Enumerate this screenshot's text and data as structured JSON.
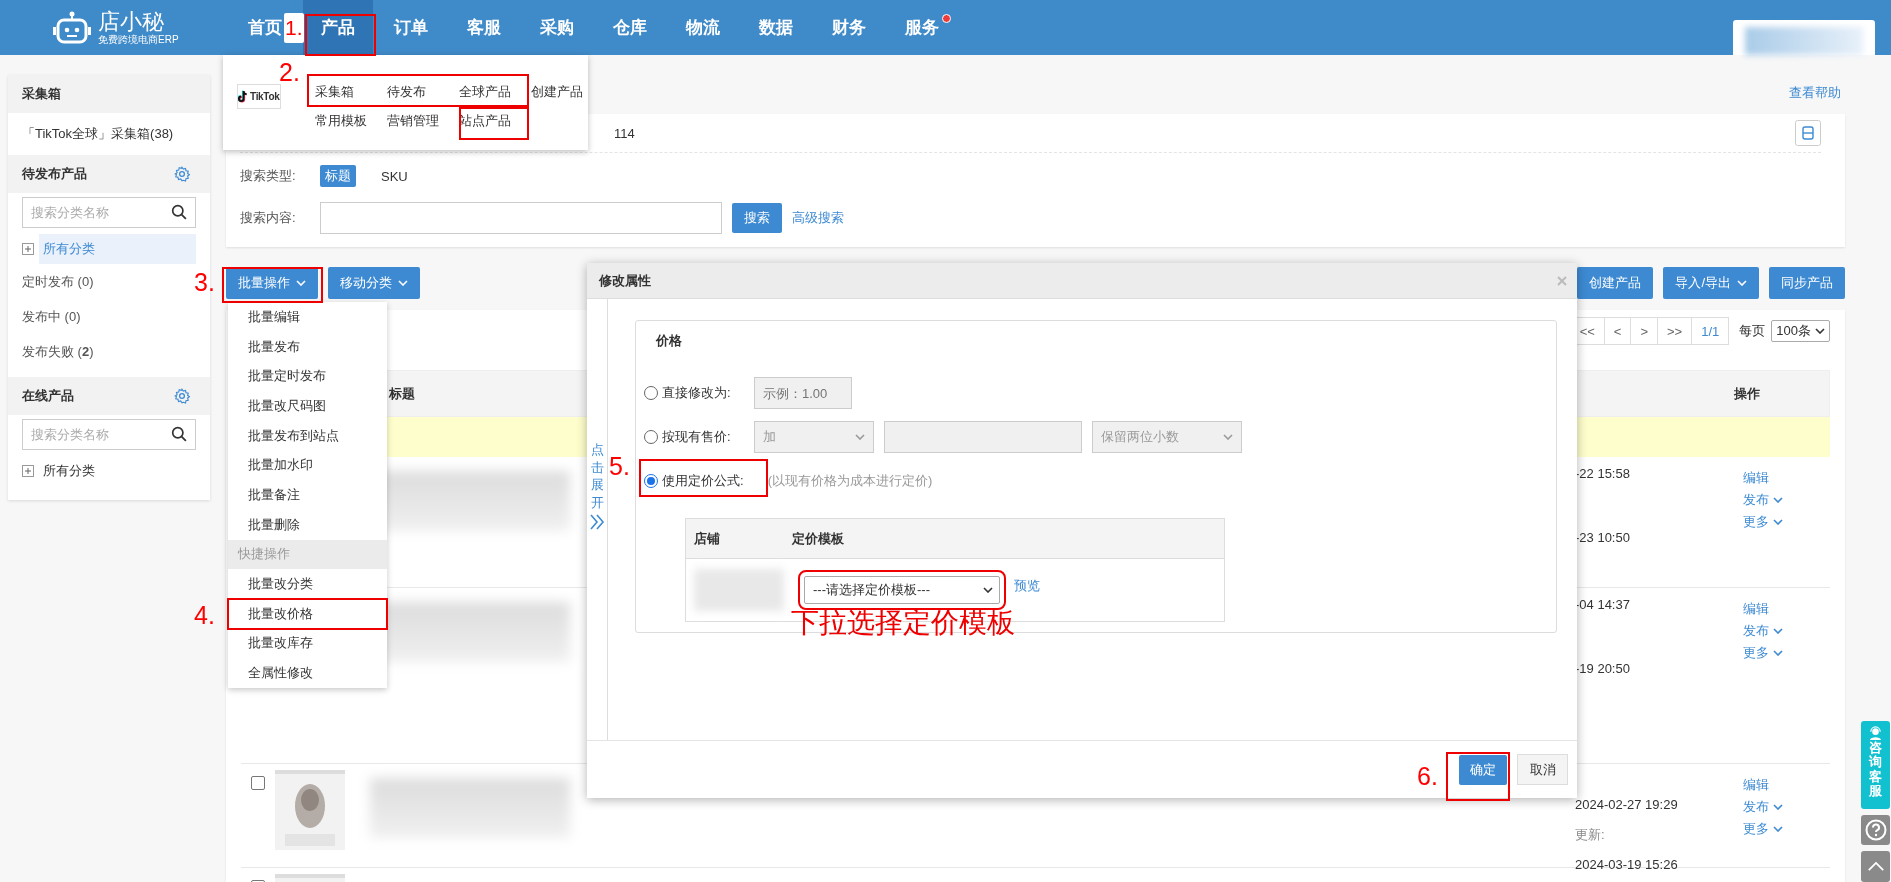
{
  "top_nav": {
    "logo_name": "店小秘",
    "logo_tagline": "免费跨境电商ERP",
    "items": [
      {
        "label": "首页",
        "selected": false,
        "badge": false
      },
      {
        "label": "产品",
        "selected": true,
        "badge": false
      },
      {
        "label": "订单",
        "selected": false,
        "badge": false
      },
      {
        "label": "客服",
        "selected": false,
        "badge": false
      },
      {
        "label": "采购",
        "selected": false,
        "badge": false
      },
      {
        "label": "仓库",
        "selected": false,
        "badge": false
      },
      {
        "label": "物流",
        "selected": false,
        "badge": false
      },
      {
        "label": "数据",
        "selected": false,
        "badge": false
      },
      {
        "label": "财务",
        "selected": false,
        "badge": false
      },
      {
        "label": "服务",
        "selected": false,
        "badge": true
      }
    ]
  },
  "product_menu": {
    "platform_logo": "TikTok",
    "rows": [
      [
        {
          "label": "采集箱"
        },
        {
          "label": "待发布"
        },
        {
          "label": "全球产品"
        },
        {
          "label": "创建产品"
        }
      ],
      [
        {
          "label": "常用模板"
        },
        {
          "label": "营销管理"
        },
        {
          "label": "站点产品"
        }
      ]
    ]
  },
  "sidebar": {
    "collect_title": "采集箱",
    "collect_items": [
      {
        "label": "「TikTok全球」采集箱(38)"
      }
    ],
    "pending": {
      "title": "待发布产品",
      "search_placeholder": "搜索分类名称",
      "tree_label": "所有分类",
      "tree_selected": true,
      "statuses": [
        {
          "label": "定时发布 (0)"
        },
        {
          "label": "发布中 (0)"
        },
        {
          "label": "发布失败 (**2**)"
        }
      ]
    },
    "online": {
      "title": "在线产品",
      "search_placeholder": "搜索分类名称",
      "tree_label": "所有分类",
      "tree_selected": false
    }
  },
  "help_link": "查看帮助",
  "search_panel": {
    "store_text": "114",
    "type_label": "搜索类型:",
    "types": [
      {
        "label": "标题",
        "selected": true
      },
      {
        "label": "SKU",
        "selected": false
      }
    ],
    "content_label": "搜索内容:",
    "search_button": "搜索",
    "advanced_link": "高级搜索"
  },
  "toolbar": {
    "left": [
      {
        "label": "批量操作",
        "caret": true
      },
      {
        "label": "移动分类",
        "caret": true
      }
    ],
    "right": [
      {
        "label": "创建产品",
        "caret": false
      },
      {
        "label": "导入/导出",
        "caret": true
      },
      {
        "label": "同步产品",
        "caret": false
      }
    ]
  },
  "batch_menu": [
    {
      "kind": "item",
      "label": "批量编辑"
    },
    {
      "kind": "item",
      "label": "批量发布"
    },
    {
      "kind": "item",
      "label": "批量定时发布"
    },
    {
      "kind": "item",
      "label": "批量改尺码图"
    },
    {
      "kind": "item",
      "label": "批量发布到站点"
    },
    {
      "kind": "item",
      "label": "批量加水印"
    },
    {
      "kind": "item",
      "label": "批量备注"
    },
    {
      "kind": "item",
      "label": "批量删除"
    },
    {
      "kind": "header",
      "label": "快捷操作"
    },
    {
      "kind": "item",
      "label": "批量改分类"
    },
    {
      "kind": "item",
      "label": "批量改价格"
    },
    {
      "kind": "item",
      "label": "批量改库存"
    },
    {
      "kind": "item",
      "label": "全属性修改"
    }
  ],
  "pagination": {
    "buttons": [
      "<<",
      "<",
      ">",
      ">>"
    ],
    "page": "1/1",
    "per_page_label": "每页",
    "per_page": "100条"
  },
  "table": {
    "columns": [
      {
        "label": "标题"
      },
      {
        "label": "操作"
      }
    ],
    "rows": [
      {
        "lines": [
          {
            "kind": "time",
            "text": "-22 15:58"
          },
          {
            "kind": "time",
            "text": "-23 10:50"
          }
        ],
        "actions": [
          {
            "label": "编辑",
            "caret": false
          },
          {
            "label": "发布",
            "caret": true
          },
          {
            "label": "更多",
            "caret": true
          }
        ]
      },
      {
        "lines": [
          {
            "kind": "time",
            "text": "-04 14:37"
          },
          {
            "kind": "time",
            "text": "-19 20:50"
          }
        ],
        "actions": [
          {
            "label": "编辑",
            "caret": false
          },
          {
            "label": "发布",
            "caret": true
          },
          {
            "label": "更多",
            "caret": true
          }
        ]
      },
      {
        "checked": false,
        "image": {
          "kind": "picture"
        },
        "lines": [
          {
            "kind": "time",
            "text": "2024-02-27 19:29"
          },
          {
            "kind": "label",
            "text": "更新:"
          },
          {
            "kind": "time",
            "text": "2024-03-19 15:26"
          }
        ],
        "actions": [
          {
            "label": "编辑",
            "caret": false
          },
          {
            "label": "发布",
            "caret": true
          },
          {
            "label": "更多",
            "caret": true
          }
        ]
      },
      {
        "checked": false,
        "image": {
          "kind": "picture"
        },
        "lines": [],
        "actions": []
      }
    ]
  },
  "dialog": {
    "title": "修改属性",
    "expand_link": "点击展开",
    "section_title": "价格",
    "options": [
      {
        "kind": "input",
        "label": "直接修改为:",
        "selected": false,
        "placeholder": "示例：1.00"
      },
      {
        "kind": "adjust",
        "label": "按现有售价:",
        "selected": false,
        "operator": "加",
        "rounding": "保留两位小数"
      },
      {
        "kind": "formula",
        "label": "使用定价公式:",
        "selected": true,
        "hint": "(以现有价格为成本进行定价)"
      }
    ],
    "template_table": {
      "columns": [
        {
          "label": "店铺"
        },
        {
          "label": "定价模板"
        }
      ],
      "rows": [
        {
          "template_placeholder": "---请选择定价模板---",
          "preview_link": "预览"
        }
      ]
    },
    "ok_button": "确定",
    "cancel_button": "取消"
  },
  "annotations": [
    {
      "label": "1."
    },
    {
      "label": "2."
    },
    {
      "label": "3."
    },
    {
      "label": "4."
    },
    {
      "label": "5."
    },
    {
      "label": "6."
    }
  ],
  "caption": "下拉选择定价模板",
  "floating": {
    "service_label": "咨询客服"
  }
}
